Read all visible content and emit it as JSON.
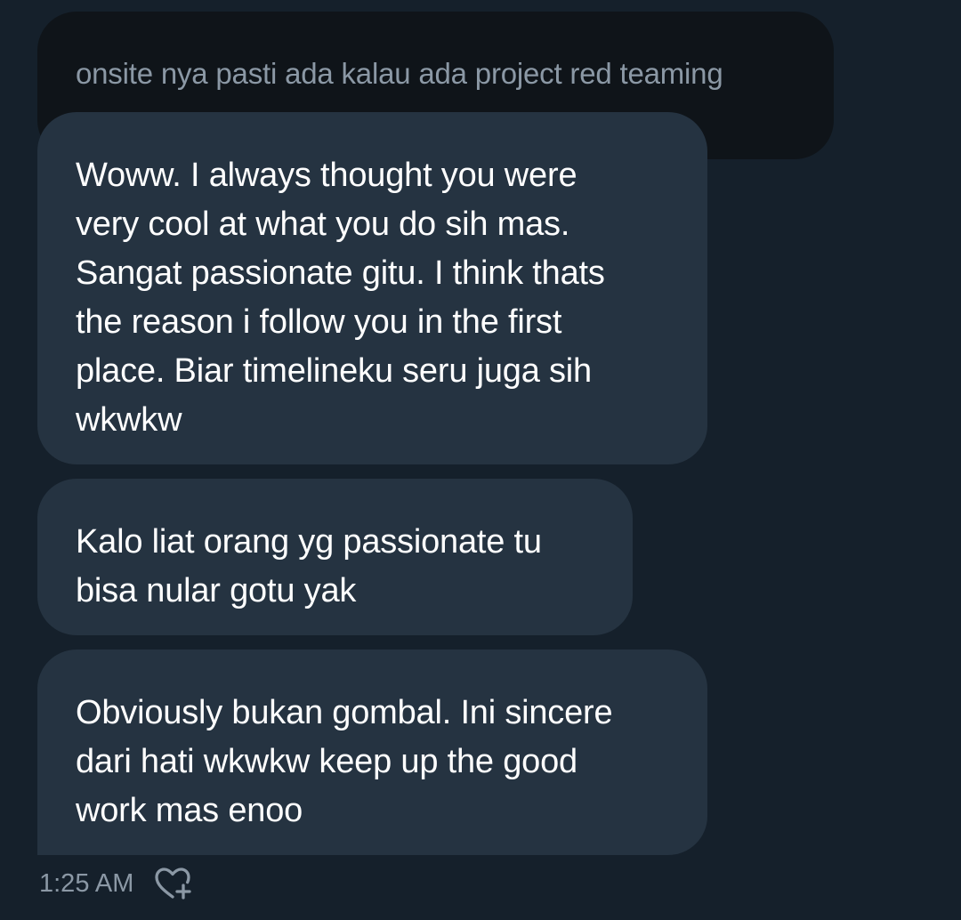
{
  "conversation": {
    "quoted_message": "onsite nya pasti ada kalau ada project red teaming",
    "messages": [
      {
        "text": "Woww. I always thought you were\nvery cool at what you do sih mas.\nSangat passionate gitu. I think thats\nthe reason i follow you in the first\nplace. Biar timelineku seru juga sih\nwkwkw"
      },
      {
        "text": "Kalo liat orang yg passionate tu\nbisa nular gotu yak"
      },
      {
        "text": "Obviously bukan gombal. Ini sincere\ndari hati wkwkw keep up the good\nwork mas enoo"
      }
    ],
    "timestamp": "1:25 AM",
    "react_icon": "heart-plus-icon"
  },
  "colors": {
    "background": "#15202b",
    "quoted_bubble": "#0f1419",
    "message_bubble": "#253341",
    "muted_text": "#8b98a5",
    "message_text": "#ffffff"
  }
}
